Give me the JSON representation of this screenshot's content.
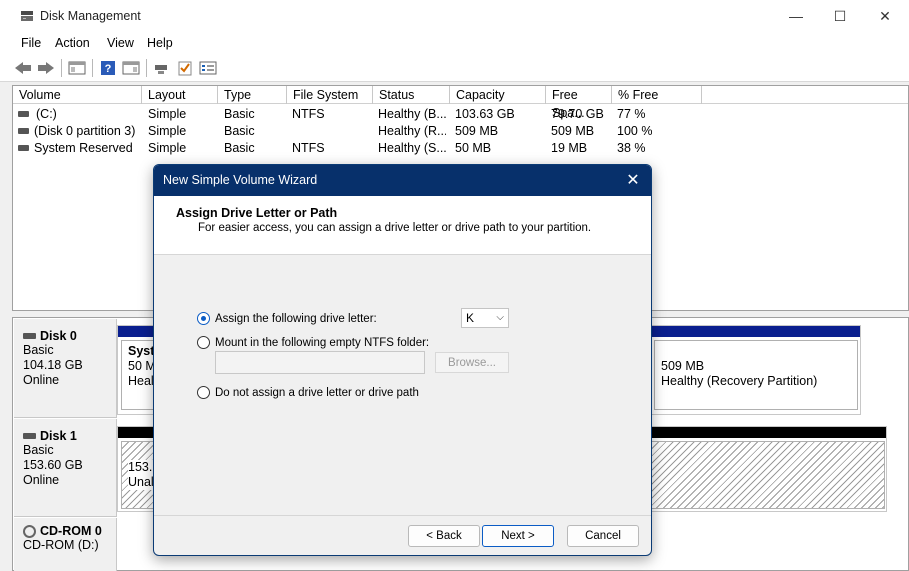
{
  "window": {
    "title": "Disk Management",
    "minimize_icon": "—",
    "maximize_icon": "☐",
    "close_icon": "✕"
  },
  "menu": [
    "File",
    "Action",
    "View",
    "Help"
  ],
  "volume_list": {
    "columns": [
      "Volume",
      "Layout",
      "Type",
      "File System",
      "Status",
      "Capacity",
      "Free Spa...",
      "% Free"
    ],
    "rows": [
      [
        "(C:)",
        "Simple",
        "Basic",
        "NTFS",
        "Healthy (B...",
        "103.63 GB",
        "79.70 GB",
        "77 %"
      ],
      [
        "(Disk 0 partition 3)",
        "Simple",
        "Basic",
        "",
        "Healthy (R...",
        "509 MB",
        "509 MB",
        "100 %"
      ],
      [
        "System Reserved",
        "Simple",
        "Basic",
        "NTFS",
        "Healthy (S...",
        "50 MB",
        "19 MB",
        "38 %"
      ]
    ]
  },
  "disks": [
    {
      "name": "Disk 0",
      "type": "Basic",
      "size": "104.18 GB",
      "state": "Online",
      "left_part": {
        "title": "Syste",
        "line2": "50 MI",
        "line3": "Healt"
      },
      "right_part": {
        "size": "509 MB",
        "status": "Healthy (Recovery Partition)"
      }
    },
    {
      "name": "Disk 1",
      "type": "Basic",
      "size": "153.60 GB",
      "state": "Online",
      "left_part": {
        "line1": "153.6",
        "line2": "Unall"
      }
    },
    {
      "name": "CD-ROM 0",
      "detail": "CD-ROM (D:)"
    }
  ],
  "wizard": {
    "title": "New Simple Volume Wizard",
    "close_icon": "✕",
    "heading": "Assign Drive Letter or Path",
    "subtitle": "For easier access, you can assign a drive letter or drive path to your partition.",
    "option_assign": "Assign the following drive letter:",
    "option_mount": "Mount in the following empty NTFS folder:",
    "option_none": "Do not assign a drive letter or drive path",
    "selected_letter": "K",
    "combo_arrow": "⌵",
    "path_value": "",
    "browse_label": "Browse...",
    "back_label": "< Back",
    "next_label": "Next >",
    "cancel_label": "Cancel"
  },
  "colors": {
    "wizard_titlebar": "#07306b",
    "disk_bar_blue": "#0a1f8f",
    "radio_accent": "#0b5cc5"
  }
}
